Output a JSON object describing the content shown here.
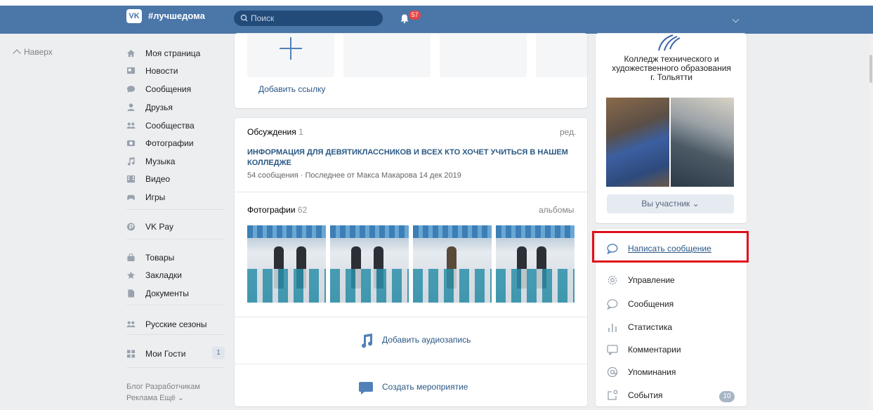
{
  "header": {
    "logo_text": "VK",
    "brand": "#лучшедома",
    "search_placeholder": "Поиск",
    "notifications_count": "57"
  },
  "back_to_top": "Наверх",
  "sidebar": {
    "items": [
      {
        "label": "Моя страница",
        "icon": "home-icon"
      },
      {
        "label": "Новости",
        "icon": "news-icon"
      },
      {
        "label": "Сообщения",
        "icon": "messages-icon"
      },
      {
        "label": "Друзья",
        "icon": "friends-icon"
      },
      {
        "label": "Сообщества",
        "icon": "communities-icon"
      },
      {
        "label": "Фотографии",
        "icon": "photos-icon"
      },
      {
        "label": "Музыка",
        "icon": "music-icon"
      },
      {
        "label": "Видео",
        "icon": "video-icon"
      },
      {
        "label": "Игры",
        "icon": "games-icon"
      },
      {
        "label": "VK Pay",
        "icon": "vkpay-icon"
      },
      {
        "label": "Товары",
        "icon": "goods-icon"
      },
      {
        "label": "Закладки",
        "icon": "bookmarks-icon"
      },
      {
        "label": "Документы",
        "icon": "documents-icon"
      },
      {
        "label": "Русские сезоны",
        "icon": "russian-seasons-icon"
      },
      {
        "label": "Мои Гости",
        "icon": "guests-icon",
        "count": "1"
      }
    ],
    "footer": {
      "line1": "Блог  Разработчикам",
      "line2": "Реклама  Ещё ⌄"
    }
  },
  "links_block": {
    "add_link": "Добавить ссылку"
  },
  "discussions": {
    "title": "Обсуждения",
    "count": "1",
    "action": "ред.",
    "topic_title": "ИНФОРМАЦИЯ ДЛЯ ДЕВЯТИКЛАССНИКОВ И ВСЕХ КТО ХОЧЕТ УЧИТЬСЯ В НАШЕМ КОЛЛЕДЖЕ",
    "topic_meta": "54 сообщения · Последнее от Макса Макарова 14 дек 2019"
  },
  "photos": {
    "title": "Фотографии",
    "count": "62",
    "action": "альбомы",
    "items": 4
  },
  "actions": {
    "add_audio": "Добавить аудиозапись",
    "create_event": "Создать мероприятие"
  },
  "group": {
    "name_line1": "Колледж технического и",
    "name_line2": "художественного образования",
    "name_line3": "г. Тольятти",
    "member_button": "Вы участник ⌄"
  },
  "group_menu": {
    "items": [
      {
        "label": "Написать сообщение",
        "icon": "message-bubble-icon"
      },
      {
        "label": "Управление",
        "icon": "gear-icon"
      },
      {
        "label": "Сообщения",
        "icon": "messages-icon"
      },
      {
        "label": "Статистика",
        "icon": "stats-icon"
      },
      {
        "label": "Комментарии",
        "icon": "comments-icon"
      },
      {
        "label": "Упоминания",
        "icon": "at-icon"
      },
      {
        "label": "События",
        "icon": "events-icon",
        "count": "10"
      }
    ]
  },
  "colors": {
    "header": "#4a76a8",
    "link": "#2a5885",
    "highlight_border": "#e0101b"
  }
}
